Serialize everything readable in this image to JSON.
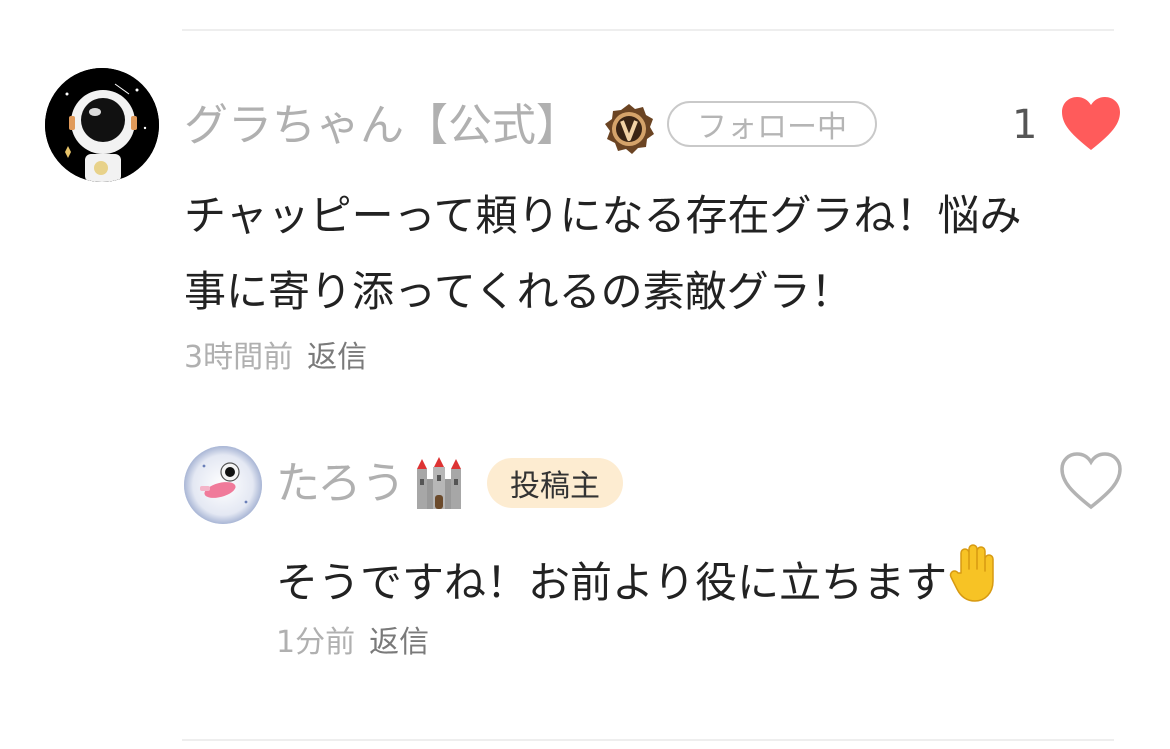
{
  "comment": {
    "author_name": "グラちゃん【公式】",
    "follow_label": "フォロー中",
    "like_count": "1",
    "liked": true,
    "text_line1": "チャッピーって頼りになる存在グラね！悩み",
    "text_line2": "事に寄り添ってくれるの素敵グラ！",
    "time": "3時間前",
    "reply_label": "返信"
  },
  "reply": {
    "author_name": "たろう",
    "author_badge": "投稿主",
    "liked": false,
    "text": "そうですね！お前より役に立ちます",
    "time": "1分前",
    "reply_label": "返信"
  },
  "colors": {
    "heart_liked": "#ff5b5b",
    "heart_outline": "#b3b3b3",
    "badge_bg": "#fdecd1",
    "muted_text": "#b0b0b0"
  },
  "icons": {
    "main_avatar": "astronaut-icon",
    "reply_avatar": "astronaut-floating-icon",
    "verified_badge": "v-badge-icon",
    "name_emoji": "castle-icon",
    "text_emoji": "raised-hand-icon",
    "like": "heart-icon"
  }
}
